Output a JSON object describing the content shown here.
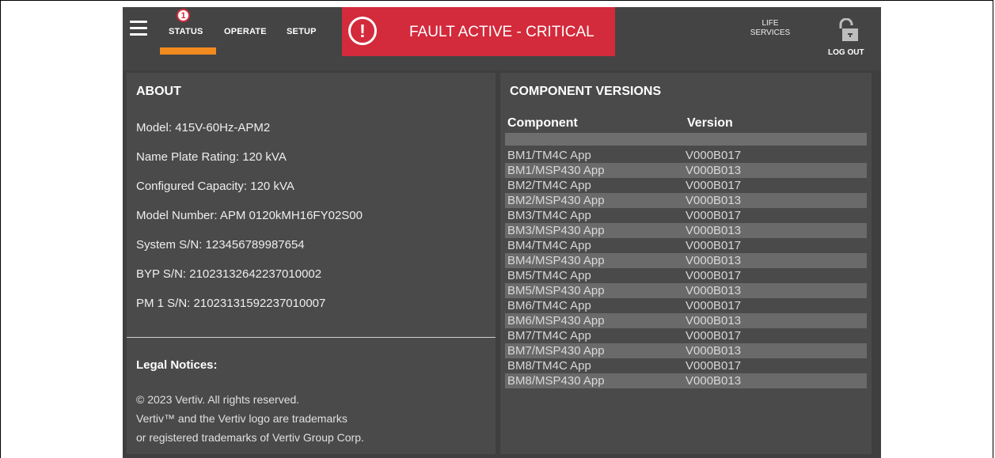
{
  "nav": {
    "status_label": "STATUS",
    "status_badge": "1",
    "operate_label": "OPERATE",
    "setup_label": "SETUP",
    "active_tab": "STATUS",
    "accent_color": "#f18a1f"
  },
  "fault": {
    "icon": "!",
    "text": "FAULT ACTIVE - CRITICAL",
    "color": "#d32a3c"
  },
  "header_right": {
    "life_line1": "LIFE",
    "life_line2": "SERVICES",
    "logout_label": "LOG OUT",
    "lock_icon": "unlocked-padlock-icon"
  },
  "about": {
    "title": "ABOUT",
    "lines": [
      "Model: 415V-60Hz-APM2",
      "Name Plate Rating: 120 kVA",
      "Configured Capacity: 120 kVA",
      "Model Number: APM 0120kMH16FY02S00",
      "System S/N: 123456789987654",
      "BYP S/N: 21023132642237010002",
      "PM 1 S/N: 21023131592237010007"
    ]
  },
  "legal": {
    "title": "Legal Notices:",
    "lines": [
      "© 2023 Vertiv. All rights reserved.",
      "Vertiv™ and the Vertiv logo are trademarks",
      "or registered trademarks of Vertiv Group Corp."
    ]
  },
  "versions": {
    "title": "COMPONENT VERSIONS",
    "col_component": "Component",
    "col_version": "Version",
    "rows": [
      {
        "component": "BM1/TM4C App",
        "version": "V000B017"
      },
      {
        "component": "BM1/MSP430 App",
        "version": "V000B013"
      },
      {
        "component": "BM2/TM4C App",
        "version": "V000B017"
      },
      {
        "component": "BM2/MSP430 App",
        "version": "V000B013"
      },
      {
        "component": "BM3/TM4C App",
        "version": "V000B017"
      },
      {
        "component": "BM3/MSP430 App",
        "version": "V000B013"
      },
      {
        "component": "BM4/TM4C App",
        "version": "V000B017"
      },
      {
        "component": "BM4/MSP430 App",
        "version": "V000B013"
      },
      {
        "component": "BM5/TM4C App",
        "version": "V000B017"
      },
      {
        "component": "BM5/MSP430 App",
        "version": "V000B013"
      },
      {
        "component": "BM6/TM4C App",
        "version": "V000B017"
      },
      {
        "component": "BM6/MSP430 App",
        "version": "V000B013"
      },
      {
        "component": "BM7/TM4C App",
        "version": "V000B017"
      },
      {
        "component": "BM7/MSP430 App",
        "version": "V000B013"
      },
      {
        "component": "BM8/TM4C App",
        "version": "V000B017"
      },
      {
        "component": "BM8/MSP430 App",
        "version": "V000B013"
      }
    ]
  }
}
